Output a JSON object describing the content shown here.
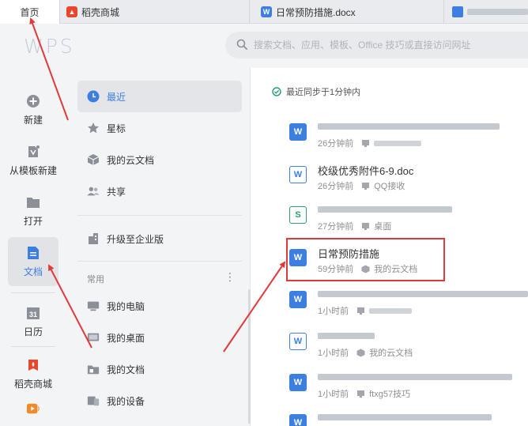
{
  "tabs": [
    {
      "label": "首页"
    },
    {
      "label": "稻壳商城"
    },
    {
      "label": "日常预防措施.docx"
    },
    {
      "label": ""
    }
  ],
  "header": {
    "logo": "WPS",
    "search_placeholder": "搜索文档、应用、模板、Office 技巧或直接访问网址"
  },
  "rail": [
    {
      "label": "新建"
    },
    {
      "label": "从模板新建"
    },
    {
      "label": "打开"
    },
    {
      "label": "文档"
    },
    {
      "label": "日历"
    },
    {
      "label": "稻壳商城"
    }
  ],
  "calendar_day": "31",
  "nav": {
    "items": [
      {
        "label": "最近"
      },
      {
        "label": "星标"
      },
      {
        "label": "我的云文档"
      },
      {
        "label": "共享"
      }
    ],
    "upgrade": "升级至企业版",
    "section_title": "常用",
    "more": "⋮",
    "common": [
      {
        "label": "我的电脑"
      },
      {
        "label": "我的桌面"
      },
      {
        "label": "我的文档"
      },
      {
        "label": "我的设备"
      }
    ]
  },
  "main": {
    "sync_text": "最近同步于1分钟内",
    "files": [
      {
        "name": "",
        "time": "26分钟前",
        "location": ""
      },
      {
        "name": "校级优秀附件6-9.doc",
        "time": "26分钟前",
        "location": "QQ接收"
      },
      {
        "name": "",
        "time": "27分钟前",
        "location": "桌面"
      },
      {
        "name": "日常预防措施",
        "time": "59分钟前",
        "location": "我的云文档"
      },
      {
        "name": "",
        "time": "1小时前",
        "location": ""
      },
      {
        "name": "",
        "time": "1小时前",
        "location": "我的云文档"
      },
      {
        "name": "",
        "time": "1小时前",
        "location": "ftxg57技巧"
      },
      {
        "name": "",
        "time": "",
        "location": ""
      }
    ]
  },
  "colors": {
    "accent": "#3d7fe0",
    "highlight": "#e03a3a",
    "sheet_green": "#27a06e"
  }
}
